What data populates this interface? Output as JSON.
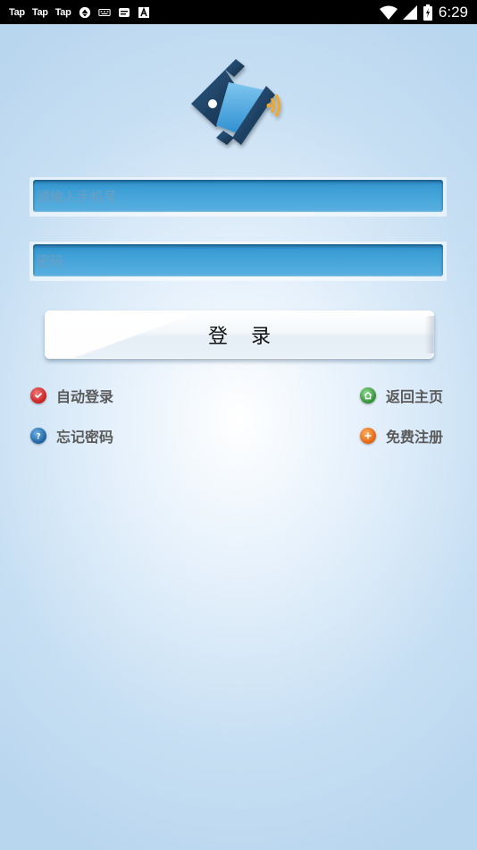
{
  "status_bar": {
    "apps": [
      "Tap",
      "Tap",
      "Tap"
    ],
    "icons": [
      "sync-icon",
      "keyboard-icon",
      "message-icon",
      "font-icon"
    ],
    "right_icons": [
      "wifi-icon",
      "signal-icon",
      "battery-icon"
    ],
    "time": "6:29"
  },
  "logo": {
    "icon": "app-logo-icon",
    "colors": {
      "dark": "#1d3a5c",
      "accent": "#f5a623"
    }
  },
  "form": {
    "phone_placeholder": "请输入手机号",
    "password_placeholder": "密码",
    "login_label": "登录"
  },
  "options": {
    "auto_login": {
      "label": "自动登录",
      "icon": "check-icon"
    },
    "forgot_password": {
      "label": "忘记密码",
      "icon": "question-icon"
    },
    "back_home": {
      "label": "返回主页",
      "icon": "home-icon"
    },
    "register": {
      "label": "免费注册",
      "icon": "plus-icon"
    }
  }
}
